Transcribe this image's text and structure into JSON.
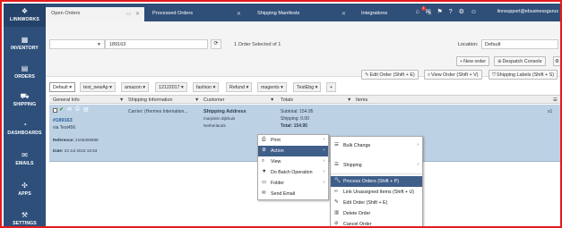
{
  "sidebar": {
    "items": [
      {
        "label": "LINNWORKS",
        "icon": "linnworks-logo-icon"
      },
      {
        "label": "INVENTORY",
        "icon": "inventory-icon"
      },
      {
        "label": "ORDERS",
        "icon": "orders-icon"
      },
      {
        "label": "SHIPPING",
        "icon": "shipping-icon"
      },
      {
        "label": "DASHBOARDS",
        "icon": "dashboards-icon"
      },
      {
        "label": "EMAILS",
        "icon": "emails-icon"
      },
      {
        "label": "APPS",
        "icon": "apps-icon"
      },
      {
        "label": "SETTINGS",
        "icon": "settings-icon"
      }
    ]
  },
  "tabs": [
    {
      "label": "Open Orders"
    },
    {
      "label": "Processed Orders"
    },
    {
      "label": "Shipping Manifests"
    },
    {
      "label": "Integrations"
    }
  ],
  "header": {
    "user": "linnsupport@ebusinessgurus",
    "badge": "1"
  },
  "toolbar": {
    "search_value": "189163",
    "selection": "1 Order Selected of 1",
    "location_label": "Location:",
    "location_value": "Default",
    "new_order": "New order",
    "despatch_console": "Despatch Console",
    "edit_order": "Edit Order (Shift + E)",
    "view_order": "View Order (Shift + V)",
    "shipping_labels": "Shipping Labels (Shift + S)"
  },
  "chips": [
    "Default",
    "test_newAp",
    "amazon",
    "12122017",
    "fashion",
    "Refund",
    "magento",
    "TestEbg",
    "+"
  ],
  "columns": {
    "general": "General Info",
    "shipping": "Shipping Information",
    "customer": "Customer",
    "totals": "Totals",
    "items": "Items"
  },
  "order": {
    "number": "#189163",
    "source": "via Test456",
    "reference_label": "Reference:",
    "reference": "2105309689",
    "date_label": "Date:",
    "date": "23 Jul 2018 16:53",
    "carrier": "Carrier: (Hermes Internation...",
    "customer_title": "Shipping Address",
    "customer_name": "marjolein dijkhuis",
    "customer_country": "Netherlands",
    "subtotal": "Subtotal: 154.95",
    "shipping": "Shipping: 0.00",
    "total": "Total: 154.95",
    "qty": "x1"
  },
  "menu1": [
    {
      "label": "Print",
      "icon": "print-icon",
      "sub": true
    },
    {
      "label": "Action",
      "icon": "gear-icon",
      "sub": true,
      "hl": true
    },
    {
      "label": "View",
      "icon": "search-icon",
      "sub": true
    },
    {
      "label": "Do Batch Operation",
      "icon": "filter-icon",
      "sub": true
    },
    {
      "label": "Folder",
      "icon": "folder-icon",
      "sub": true
    },
    {
      "label": "Send Email",
      "icon": "envelope-icon",
      "sub": false
    }
  ],
  "menu2": [
    {
      "label": "Bulk Change",
      "icon": "list-icon",
      "sub": true
    },
    {
      "label": "Shipping",
      "icon": "list-icon",
      "sub": true
    },
    {
      "label": "Process Orders (Shift + P)",
      "icon": "wrench-icon",
      "hl": true
    },
    {
      "label": "Link Unassigned Items (Shift + U)",
      "icon": "link-icon"
    },
    {
      "label": "Edit Order (Shift + E)",
      "icon": "pencil-icon"
    },
    {
      "label": "Delete Order",
      "icon": "trash-icon"
    },
    {
      "label": "Cancel Order",
      "icon": "cancel-icon"
    }
  ]
}
